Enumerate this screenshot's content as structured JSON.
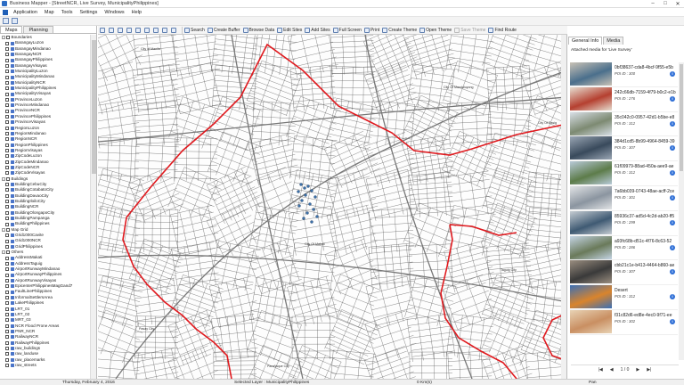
{
  "window": {
    "title": "Business Mapper - [StreetNCR, Live Survey, MunicipalityPhilippines]",
    "controls": [
      "minimize-icon",
      "maximize-icon",
      "close-icon"
    ]
  },
  "menu": [
    "Application",
    "Map",
    "Tools",
    "Settings",
    "Windows",
    "Help"
  ],
  "left_panel": {
    "tabs": [
      "Maps",
      "Planning"
    ],
    "groups": [
      {
        "name": "Boundaries",
        "items": [
          "BarangayLuzon",
          "BarangayMindanao",
          "BarangayNCR",
          "BarangayPhilippines",
          "BarangayVisayas",
          "MunicipalityLuzon",
          "MunicipalityMindanao",
          "MunicipalityNCR",
          "MunicipalityPhilippines",
          "MunicipalityVisayas",
          "ProvinceLuzon",
          "ProvinceMindanao",
          "ProvinceNCR",
          "ProvincePhilippines",
          "ProvinceVisayas",
          "RegionLuzon",
          "RegionMindanao",
          "RegionNCR",
          "RegionPhilippines",
          "RegionVisayas",
          "ZipCodeLuzon",
          "ZipCodeMindanao",
          "ZipCodeNCR",
          "ZipCodeVisayas"
        ]
      },
      {
        "name": "Buildings",
        "items": [
          "BuildingCebuCity",
          "BuildingCotabatoCity",
          "BuildingDavaoCity",
          "BuildingIloiloCity",
          "BuildingNCR",
          "BuildingOlongapoCity",
          "BuildingPampanga",
          "BuildingPhilippines"
        ]
      },
      {
        "name": "Map Grid",
        "items": [
          "Grid1000Cavite",
          "Grid1000NCR",
          "GridPhilippines"
        ]
      },
      {
        "name": "Others",
        "items": [
          "AddressMakati",
          "AddressTaguig",
          "AirportRunwayMindanao",
          "AirportRunwayPhilippines",
          "AirportRunwayVisayas",
          "EpicenterPhilippinesMagGand7",
          "FaultLinePhilippines",
          "InformalSettlersArea",
          "LakePhilippines",
          "LRT_01",
          "LRT_02",
          "MRT_03",
          "NCR Flood Prone Areas",
          "PNR_NCR",
          "RailwayNCR",
          "RailwayPhilippines",
          "raw_buildings",
          "raw_landuse",
          "raw_placemarks",
          "raw_streets"
        ]
      }
    ]
  },
  "map_toolbar": [
    {
      "label": "Search",
      "icon": "magnifier-icon",
      "enabled": true
    },
    {
      "label": "Create Buffer",
      "icon": "buffer-icon",
      "enabled": true
    },
    {
      "label": "Browse Data",
      "icon": "table-icon",
      "enabled": true
    },
    {
      "label": "Edit Sites",
      "icon": "edit-icon",
      "enabled": true
    },
    {
      "label": "Add Sites",
      "icon": "add-icon",
      "enabled": true
    },
    {
      "label": "Full Screen",
      "icon": "fullscreen-icon",
      "enabled": true
    },
    {
      "label": "Print",
      "icon": "printer-icon",
      "enabled": true
    },
    {
      "label": "Create Theme",
      "icon": "theme-icon",
      "enabled": true
    },
    {
      "label": "Open Theme",
      "icon": "folder-icon",
      "enabled": true
    },
    {
      "label": "Save Theme",
      "icon": "save-icon",
      "enabled": false
    },
    {
      "label": "Find Route",
      "icon": "route-icon",
      "enabled": true
    }
  ],
  "map": {
    "labels": {
      "city_manila": "City of Manila",
      "city_mandaluyong": "City Of Mandaluyong",
      "city_pasig": "City Of Pasig",
      "city_makati": "City Of Makati",
      "city_pasay": "Pasay City",
      "city_taguig": "Taguig City",
      "city_paranaque": "Parañaque City"
    },
    "boundary_color": "#e0191e"
  },
  "right_panel": {
    "tabs": [
      "General Info",
      "Media"
    ],
    "header": "Attached media for 'Live Survey'",
    "media": [
      {
        "name": "0bf38637-cda8-4bcf-9f55-e5b",
        "poi": "POI ID : 300",
        "thumb": [
          "#4a6f8c",
          "#c9c2b6"
        ]
      },
      {
        "name": "242c66db-7159-4f79-b0c2-e1b",
        "poi": "POI ID : 276",
        "thumb": [
          "#b54030",
          "#e6ddd0"
        ]
      },
      {
        "name": "35c042c0-0957-42d1-b5be-e8",
        "poi": "POI ID : 312",
        "thumb": [
          "#7d8a72",
          "#d8dfe6"
        ]
      },
      {
        "name": "384d1cd5-8b99-4964-8459-39",
        "poi": "POI ID : 307",
        "thumb": [
          "#394a5c",
          "#9aa6b4"
        ]
      },
      {
        "name": "61f09979-88ad-450a-aee9-ae",
        "poi": "POI ID : 312",
        "thumb": [
          "#5d7c4a",
          "#b8cad8"
        ]
      },
      {
        "name": "7a6bb039-0743-48ae-acff-2ce",
        "poi": "POI ID : 301",
        "thumb": [
          "#8b95a0",
          "#e2e4e6"
        ]
      },
      {
        "name": "85936c37-ad5d-4c2d-ab20-ff5",
        "poi": "POI ID : 299",
        "thumb": [
          "#3f5a73",
          "#c5ccd2"
        ]
      },
      {
        "name": "a93fc68b-d51c-4f76-8c63-52",
        "poi": "POI ID : 286",
        "thumb": [
          "#6a7a5a",
          "#c4d4e4"
        ]
      },
      {
        "name": "cbb21c1e-b413-4464-b860-ae",
        "poi": "POI ID : 307",
        "thumb": [
          "#3a3a3a",
          "#9a8e80"
        ]
      },
      {
        "name": "Desert",
        "poi": "POI ID : 312",
        "thumb": [
          "#d9842c",
          "#3a6fb5"
        ]
      },
      {
        "name": "f31c82d6-ed8e-4ec0-9f71-ee",
        "poi": "POI ID : 302",
        "thumb": [
          "#c98f62",
          "#e8d3b5"
        ]
      }
    ],
    "pager": {
      "text": "1 / 0"
    }
  },
  "status_bar": {
    "date": "Thursday, February 4, 2016",
    "layer": "Selected Layer : MunicipalityPhilippines",
    "distance": "0 Km(s)",
    "mode": "Pan"
  }
}
